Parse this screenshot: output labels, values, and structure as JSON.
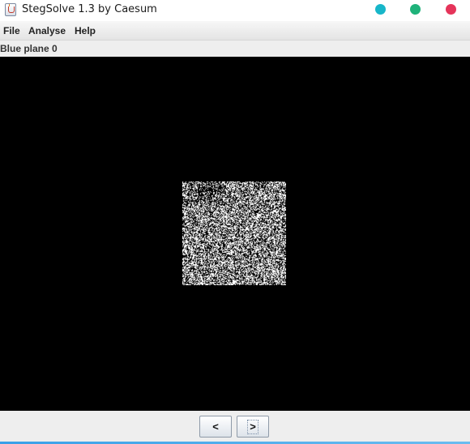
{
  "window": {
    "title": "StegSolve 1.3 by Caesum",
    "controls": [
      {
        "name": "minimize",
        "color": "#17b6c9"
      },
      {
        "name": "maximize",
        "color": "#1fb27a"
      },
      {
        "name": "close",
        "color": "#e5345a"
      }
    ]
  },
  "menu": {
    "items": [
      {
        "label": "File"
      },
      {
        "label": "Analyse"
      },
      {
        "label": "Help"
      }
    ]
  },
  "viewer": {
    "plane_label": "Blue plane 0",
    "background_color": "#000000",
    "image_style": "random-noise-black-white"
  },
  "navigation": {
    "prev_label": "<",
    "next_label": ">"
  }
}
